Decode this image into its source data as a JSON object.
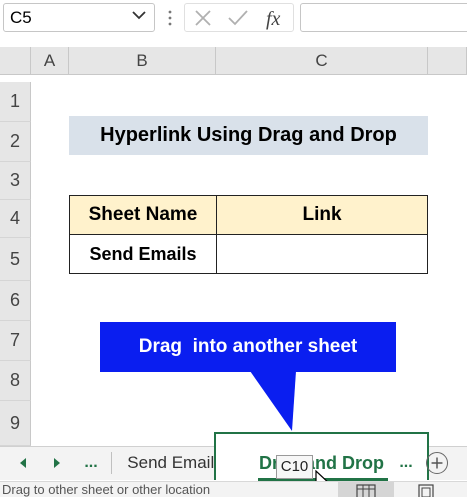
{
  "formula_bar": {
    "name_box": "C5",
    "formula": ""
  },
  "grid": {
    "columns": [
      "A",
      "B",
      "C"
    ],
    "rows": [
      "1",
      "2",
      "3",
      "4",
      "5",
      "6",
      "7",
      "8",
      "9"
    ]
  },
  "content": {
    "title": "Hyperlink Using Drag and Drop",
    "table_header_1": "Sheet Name",
    "table_header_2": "Link",
    "table_cell_b5": "Send Emails",
    "table_cell_c5": "",
    "callout": "Drag  into another sheet"
  },
  "sheet_tabs": {
    "left_dots": "...",
    "tab_1": "Send Emails",
    "tab_2": "Drag and Drop",
    "right_dots": "...",
    "drag_tooltip": "C10"
  },
  "status_bar": {
    "text": "Drag to other sheet or other location"
  },
  "colors": {
    "accent_green": "#217346",
    "callout_blue": "#0a1ef0",
    "title_fill": "#d9e1ea",
    "header_fill": "#fff2cc"
  },
  "icons": [
    "chevron-down-icon",
    "cancel-icon",
    "check-icon",
    "function-icon",
    "scroll-left-icon",
    "scroll-right-icon",
    "add-sheet-icon",
    "mouse-cursor-icon",
    "normal-view-icon",
    "page-layout-icon"
  ]
}
